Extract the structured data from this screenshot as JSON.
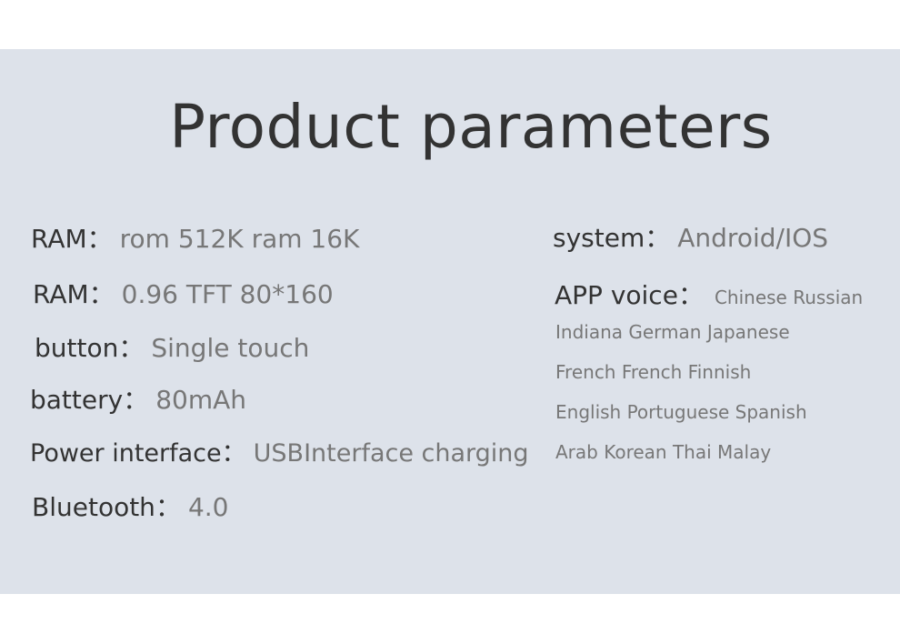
{
  "title": "Product parameters",
  "separator": "：",
  "left_params": [
    {
      "label": "RAM",
      "value": "rom 512K  ram 16K"
    },
    {
      "label": "RAM",
      "value": "0.96 TFT  80*160"
    },
    {
      "label": "button",
      "value": "Single touch"
    },
    {
      "label": "battery",
      "value": "80mAh"
    },
    {
      "label": "Power interface",
      "value": "USBInterface charging"
    },
    {
      "label": "Bluetooth",
      "value": "4.0"
    }
  ],
  "system": {
    "label": "system",
    "value": "Android/IOS"
  },
  "app_voice": {
    "label": "APP voice",
    "first_line": "Chinese Russian",
    "lines": [
      "Indiana German Japanese",
      "French French Finnish",
      "English Portuguese Spanish",
      "Arab Korean Thai Malay"
    ]
  },
  "colors": {
    "panel_background": "#dde2ea",
    "label_text": "#333333",
    "value_text": "#777777"
  }
}
